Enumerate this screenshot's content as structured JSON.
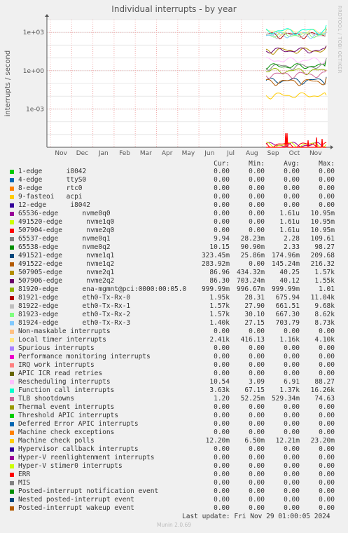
{
  "title": "Individual interrupts - by year",
  "side_label": "RRDTOOL / TOBI OETIKER",
  "footer": {
    "last_update": "Last update: Fri Nov 29 01:00:05 2024",
    "munin": "Munin 2.0.69"
  },
  "columns": [
    "Cur:",
    "Min:",
    "Avg:",
    "Max:"
  ],
  "chart_data": {
    "type": "line",
    "title": "Individual interrupts - by year",
    "ylabel": "interrupts / second",
    "yscale": "log",
    "ylim": [
      1e-06,
      10000
    ],
    "yticks": [
      "1e+03",
      "1e+00",
      "1e-03"
    ],
    "xlabels": [
      "Nov",
      "Dec",
      "Jan",
      "Feb",
      "Mar",
      "Apr",
      "May",
      "Jun",
      "Jul",
      "Aug",
      "Sep",
      "Oct",
      "Nov"
    ],
    "grid": true,
    "legend_position": "bottom",
    "series": [
      {
        "name": "1-edge      i8042",
        "color": "#00cc00",
        "cur": "0.00",
        "min": "0.00",
        "avg": "0.00",
        "max": "0.00"
      },
      {
        "name": "4-edge      ttyS0",
        "color": "#0066b3",
        "cur": "0.00",
        "min": "0.00",
        "avg": "0.00",
        "max": "0.00"
      },
      {
        "name": "8-edge      rtc0",
        "color": "#ff8000",
        "cur": "0.00",
        "min": "0.00",
        "avg": "0.00",
        "max": "0.00"
      },
      {
        "name": "9-fasteoi   acpi",
        "color": "#ffcc00",
        "cur": "0.00",
        "min": "0.00",
        "avg": "0.00",
        "max": "0.00"
      },
      {
        "name": "12-edge      i8042",
        "color": "#330099",
        "cur": "0.00",
        "min": "0.00",
        "avg": "0.00",
        "max": "0.00"
      },
      {
        "name": "65536-edge      nvme0q0",
        "color": "#990099",
        "cur": "0.00",
        "min": "0.00",
        "avg": "1.61u",
        "max": "10.95m"
      },
      {
        "name": "491520-edge      nvme1q0",
        "color": "#ccff00",
        "cur": "0.00",
        "min": "0.00",
        "avg": "1.61u",
        "max": "10.95m"
      },
      {
        "name": "507904-edge      nvme2q0",
        "color": "#ff0000",
        "cur": "0.00",
        "min": "0.00",
        "avg": "1.61u",
        "max": "10.95m"
      },
      {
        "name": "65537-edge      nvme0q1",
        "color": "#808080",
        "cur": "9.94",
        "min": "28.23m",
        "avg": "2.28",
        "max": "109.61"
      },
      {
        "name": "65538-edge      nvme0q2",
        "color": "#008f00",
        "cur": "10.15",
        "min": "90.90m",
        "avg": "2.33",
        "max": "98.27"
      },
      {
        "name": "491521-edge      nvme1q1",
        "color": "#00487d",
        "cur": "323.45m",
        "min": "25.86m",
        "avg": "174.96m",
        "max": "209.68"
      },
      {
        "name": "491522-edge      nvme1q2",
        "color": "#b35a00",
        "cur": "283.92m",
        "min": "0.00",
        "avg": "145.24m",
        "max": "216.32"
      },
      {
        "name": "507905-edge      nvme2q1",
        "color": "#b38f00",
        "cur": "86.96",
        "min": "434.32m",
        "avg": "40.25",
        "max": "1.57k"
      },
      {
        "name": "507906-edge      nvme2q2",
        "color": "#6b006b",
        "cur": "86.30",
        "min": "703.24m",
        "avg": "40.12",
        "max": "1.55k"
      },
      {
        "name": "81920-edge      ena-mgmnt@pci:0000:00:05.0",
        "color": "#8fb300",
        "cur": "999.99m",
        "min": "996.67m",
        "avg": "999.99m",
        "max": "1.01"
      },
      {
        "name": "81921-edge      eth0-Tx-Rx-0",
        "color": "#b30000",
        "cur": "1.95k",
        "min": "28.31",
        "avg": "675.94",
        "max": "11.04k"
      },
      {
        "name": "81922-edge      eth0-Tx-Rx-1",
        "color": "#bebebe",
        "cur": "1.57k",
        "min": "27.90",
        "avg": "661.51",
        "max": "9.68k"
      },
      {
        "name": "81923-edge      eth0-Tx-Rx-2",
        "color": "#80ff80",
        "cur": "1.57k",
        "min": "30.10",
        "avg": "667.30",
        "max": "8.62k"
      },
      {
        "name": "81924-edge      eth0-Tx-Rx-3",
        "color": "#80c9ff",
        "cur": "1.40k",
        "min": "27.15",
        "avg": "703.79",
        "max": "8.73k"
      },
      {
        "name": "Non-maskable interrupts",
        "color": "#ffc080",
        "cur": "0.00",
        "min": "0.00",
        "avg": "0.00",
        "max": "0.00"
      },
      {
        "name": "Local timer interrupts",
        "color": "#ffe680",
        "cur": "2.41k",
        "min": "416.13",
        "avg": "1.16k",
        "max": "4.10k"
      },
      {
        "name": "Spurious interrupts",
        "color": "#aa80ff",
        "cur": "0.00",
        "min": "0.00",
        "avg": "0.00",
        "max": "0.00"
      },
      {
        "name": "Performance monitoring interrupts",
        "color": "#ee00cc",
        "cur": "0.00",
        "min": "0.00",
        "avg": "0.00",
        "max": "0.00"
      },
      {
        "name": "IRQ work interrupts",
        "color": "#ff8080",
        "cur": "0.00",
        "min": "0.00",
        "avg": "0.00",
        "max": "0.00"
      },
      {
        "name": "APIC ICR read retries",
        "color": "#666600",
        "cur": "0.00",
        "min": "0.00",
        "avg": "0.00",
        "max": "0.00"
      },
      {
        "name": "Rescheduling interrupts",
        "color": "#ffbfff",
        "cur": "10.54",
        "min": "3.09",
        "avg": "6.91",
        "max": "88.27"
      },
      {
        "name": "Function call interrupts",
        "color": "#00ffcc",
        "cur": "3.63k",
        "min": "67.15",
        "avg": "1.37k",
        "max": "16.26k"
      },
      {
        "name": "TLB shootdowns",
        "color": "#cc6699",
        "cur": "1.20",
        "min": "52.25m",
        "avg": "529.34m",
        "max": "74.63"
      },
      {
        "name": "Thermal event interrupts",
        "color": "#999900",
        "cur": "0.00",
        "min": "0.00",
        "avg": "0.00",
        "max": "0.00"
      },
      {
        "name": "Threshold APIC interrupts",
        "color": "#00cc00",
        "cur": "0.00",
        "min": "0.00",
        "avg": "0.00",
        "max": "0.00"
      },
      {
        "name": "Deferred Error APIC interrupts",
        "color": "#0066b3",
        "cur": "0.00",
        "min": "0.00",
        "avg": "0.00",
        "max": "0.00"
      },
      {
        "name": "Machine check exceptions",
        "color": "#ff8000",
        "cur": "0.00",
        "min": "0.00",
        "avg": "0.00",
        "max": "0.00"
      },
      {
        "name": "Machine check polls",
        "color": "#ffcc00",
        "cur": "12.20m",
        "min": "6.50m",
        "avg": "12.21m",
        "max": "23.20m"
      },
      {
        "name": "Hypervisor callback interrupts",
        "color": "#330099",
        "cur": "0.00",
        "min": "0.00",
        "avg": "0.00",
        "max": "0.00"
      },
      {
        "name": "Hyper-V reenlightenment interrupts",
        "color": "#990099",
        "cur": "0.00",
        "min": "0.00",
        "avg": "0.00",
        "max": "0.00"
      },
      {
        "name": "Hyper-V stimer0 interrupts",
        "color": "#ccff00",
        "cur": "0.00",
        "min": "0.00",
        "avg": "0.00",
        "max": "0.00"
      },
      {
        "name": "ERR",
        "color": "#ff0000",
        "cur": "0.00",
        "min": "0.00",
        "avg": "0.00",
        "max": "0.00"
      },
      {
        "name": "MIS",
        "color": "#808080",
        "cur": "0.00",
        "min": "0.00",
        "avg": "0.00",
        "max": "0.00"
      },
      {
        "name": "Posted-interrupt notification event",
        "color": "#008f00",
        "cur": "0.00",
        "min": "0.00",
        "avg": "0.00",
        "max": "0.00"
      },
      {
        "name": "Nested posted-interrupt event",
        "color": "#00487d",
        "cur": "0.00",
        "min": "0.00",
        "avg": "0.00",
        "max": "0.00"
      },
      {
        "name": "Posted-interrupt wakeup event",
        "color": "#b35a00",
        "cur": "0.00",
        "min": "0.00",
        "avg": "0.00",
        "max": "0.00"
      }
    ]
  }
}
